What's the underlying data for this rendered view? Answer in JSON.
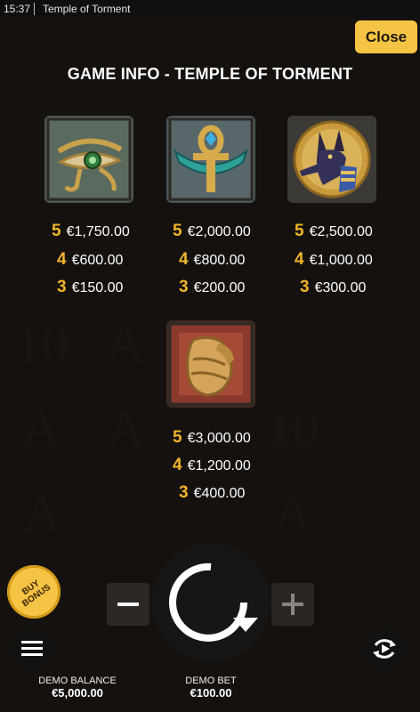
{
  "status_bar": {
    "time": "15:37",
    "title": "Temple of Torment"
  },
  "header": {
    "close_label": "Close",
    "page_title": "GAME INFO - TEMPLE OF TORMENT"
  },
  "symbols": [
    {
      "name": "eye of horus",
      "payouts": [
        {
          "count": "5",
          "amount": "€1,750.00"
        },
        {
          "count": "4",
          "amount": "€600.00"
        },
        {
          "count": "3",
          "amount": "€150.00"
        }
      ]
    },
    {
      "name": "ankh",
      "payouts": [
        {
          "count": "5",
          "amount": "€2,000.00"
        },
        {
          "count": "4",
          "amount": "€800.00"
        },
        {
          "count": "3",
          "amount": "€200.00"
        }
      ]
    },
    {
      "name": "anubis",
      "payouts": [
        {
          "count": "5",
          "amount": "€2,500.00"
        },
        {
          "count": "4",
          "amount": "€1,000.00"
        },
        {
          "count": "3",
          "amount": "€300.00"
        }
      ]
    },
    {
      "name": "urn",
      "payouts": [
        {
          "count": "5",
          "amount": "€3,000.00"
        },
        {
          "count": "4",
          "amount": "€1,200.00"
        },
        {
          "count": "3",
          "amount": "€400.00"
        }
      ]
    }
  ],
  "controls": {
    "buy_bonus_label": "BUY BONUS",
    "minus_icon": "minus-icon",
    "plus_icon": "plus-icon",
    "spin_icon": "spin-icon",
    "menu_icon": "hamburger-icon",
    "autoplay_icon": "autoplay-icon"
  },
  "footer": {
    "balance_label": "DEMO BALANCE",
    "balance_value": "€5,000.00",
    "bet_label": "DEMO BET",
    "bet_value": "€100.00"
  },
  "colors": {
    "accent": "#f6c445",
    "count": "#f1b52a",
    "background": "#1a1512"
  }
}
